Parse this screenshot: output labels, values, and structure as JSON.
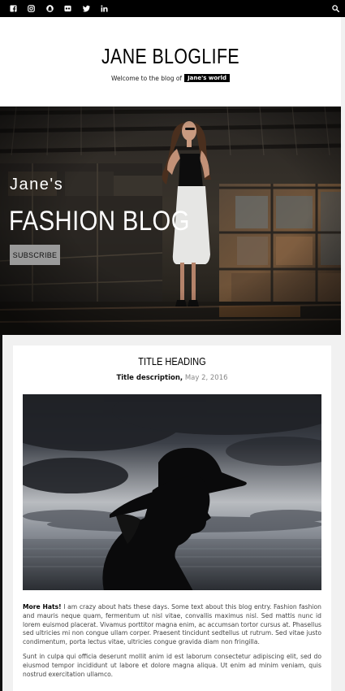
{
  "social": {
    "icons": [
      "facebook-icon",
      "instagram-icon",
      "snapchat-icon",
      "flickr-icon",
      "twitter-icon",
      "linkedin-icon"
    ],
    "search_icon": "search-icon"
  },
  "header": {
    "title": "JANE BLOGLIFE",
    "tagline_prefix": "Welcome to the blog of",
    "tagline_badge": "Jane's world"
  },
  "hero": {
    "subtitle": "Jane's",
    "title": "FASHION BLOG",
    "button_label": "SUBSCRIBE"
  },
  "post": {
    "title": "TITLE HEADING",
    "description": "Title description,",
    "date": "May 2, 2016",
    "lead_bold": "More Hats!",
    "paragraph1": "I am crazy about hats these days. Some text about this blog entry. Fashion fashion and mauris neque quam, fermentum ut nisl vitae, convallis maximus nisl. Sed mattis nunc id lorem euismod placerat. Vivamus porttitor magna enim, ac accumsan tortor cursus at. Phasellus sed ultricies mi non congue ullam corper. Praesent tincidunt sedtellus ut rutrum. Sed vitae justo condimentum, porta lectus vitae, ultricies congue gravida diam non fringilla.",
    "paragraph2": "Sunt in culpa qui officia deserunt mollit anim id est laborum consectetur adipiscing elit, sed do eiusmod tempor incididunt ut labore et dolore magna aliqua. Ut enim ad minim veniam, quis nostrud exercitation ullamco."
  },
  "colors": {
    "topbar": "#000000",
    "page_bg": "#f1f1f1",
    "button_bg": "#9a9a9a",
    "date": "#888888"
  }
}
